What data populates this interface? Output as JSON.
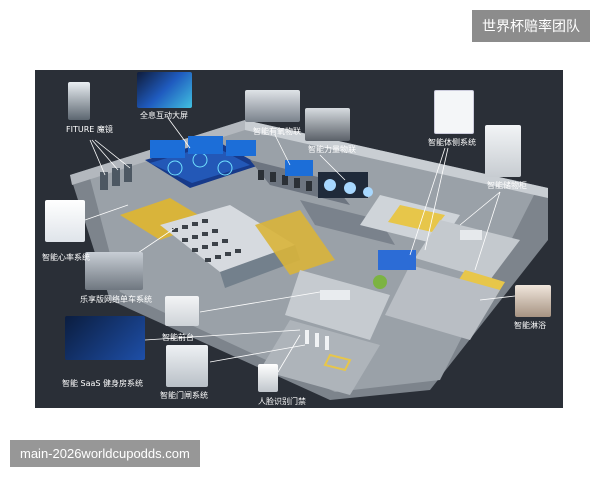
{
  "watermark": {
    "text": "世界杯赔率团队"
  },
  "footer": {
    "text": "main-2026worldcupodds.com"
  },
  "labels": {
    "fiture_mirror": "FITURE 魔镜",
    "interactive_screen": "全息互动大屏",
    "smart_aerobic": "智能有氧物联",
    "smart_strength": "智能力量物联",
    "smart_body_test": "智能体侧系统",
    "smart_locker": "智能储物柜",
    "smart_heart_rate": "智能心率系统",
    "lexiang_bike": "乐享版网络单车系统",
    "smart_shower": "智能淋浴",
    "smart_front_desk": "智能前台",
    "smart_saas": "智能 SaaS 健身房系统",
    "smart_gate": "智能门闸系统",
    "face_recognition": "人脸识别门禁"
  },
  "colors": {
    "panel_bg": "#2a2f37",
    "floor": "#8c939b",
    "wall": "#c9ced3",
    "accent_yellow": "#d9b43a",
    "screen_blue": "#2c6cd6",
    "leader_line": "#ffffff"
  }
}
